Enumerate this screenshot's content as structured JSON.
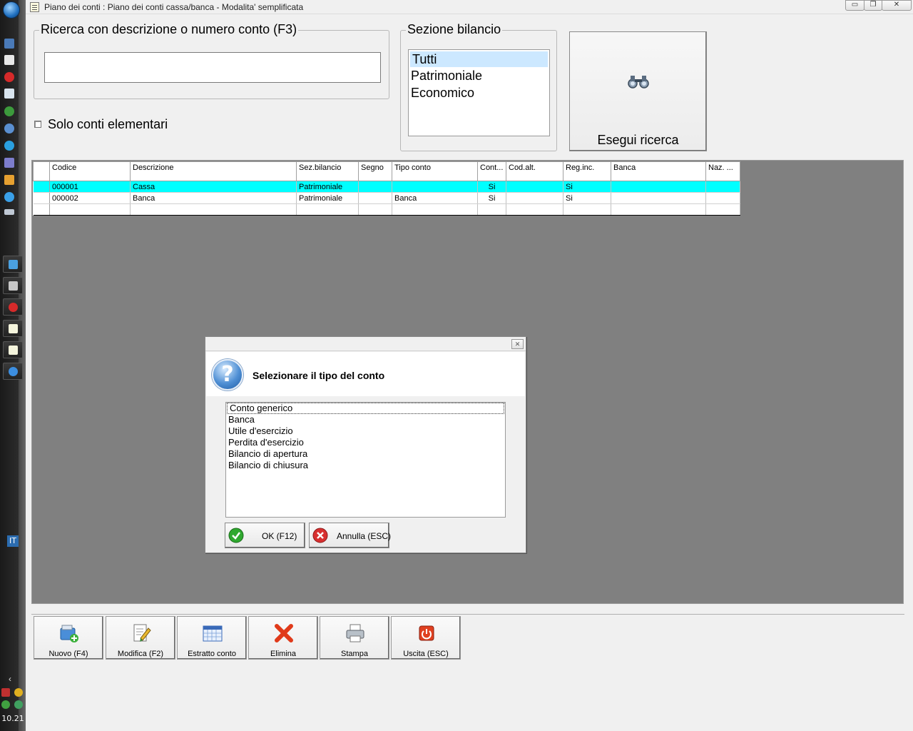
{
  "window": {
    "title": "Piano dei conti : Piano dei conti cassa/banca - Modalita' semplificata",
    "minimize_glyph": "▭",
    "restore_glyph": "❐",
    "close_glyph": "✕"
  },
  "search": {
    "group_label": "Ricerca con descrizione o numero conto (F3)",
    "value": "",
    "checkbox_label": "Solo conti elementari"
  },
  "sezione": {
    "group_label": "Sezione bilancio",
    "items": [
      "Tutti",
      "Patrimoniale",
      "Economico"
    ],
    "selected": "Tutti"
  },
  "search_button": {
    "label": "Esegui ricerca",
    "icon": "binoculars-icon"
  },
  "grid": {
    "columns": [
      "Codice",
      "Descrizione",
      "Sez.bilancio",
      "Segno",
      "Tipo conto",
      "Cont...",
      "Cod.alt.",
      "Reg.inc.",
      "Banca",
      "Naz. ..."
    ],
    "rows": [
      {
        "codice": "000001",
        "descrizione": "Cassa",
        "sez": "Patrimoniale",
        "segno": "",
        "tipo": "",
        "cont": "Si",
        "codalt": "",
        "reginc": "Si",
        "banca": "",
        "naz": ""
      },
      {
        "codice": "000002",
        "descrizione": "Banca",
        "sez": "Patrimoniale",
        "segno": "",
        "tipo": "Banca",
        "cont": "Si",
        "codalt": "",
        "reginc": "Si",
        "banca": "",
        "naz": ""
      }
    ],
    "selected_row": 0
  },
  "dialog": {
    "close_glyph": "✕",
    "help_glyph": "?",
    "message": "Selezionare il tipo del conto",
    "options": [
      "Conto generico",
      "Banca",
      "Utile d'esercizio",
      "Perdita d'esercizio",
      "Bilancio di apertura",
      "Bilancio di chiusura"
    ],
    "focused_option": "Conto generico",
    "ok_label": "OK (F12)",
    "cancel_label": "Annulla (ESC)"
  },
  "toolbar": {
    "buttons": [
      {
        "label": "Nuovo (F4)",
        "icon": "new-folder-icon"
      },
      {
        "label": "Modifica (F2)",
        "icon": "edit-document-icon"
      },
      {
        "label": "Estratto conto",
        "icon": "calendar-icon"
      },
      {
        "label": "Elimina",
        "icon": "delete-x-icon"
      },
      {
        "label": "Stampa",
        "icon": "printer-icon"
      },
      {
        "label": "Uscita (ESC)",
        "icon": "power-icon"
      }
    ]
  },
  "taskbar": {
    "language": "IT",
    "clock": "10.21",
    "collapse_glyph": "‹"
  },
  "colors": {
    "selected_row": "#00ffff",
    "list_selection": "#cce8ff",
    "grid_background": "#808080"
  }
}
